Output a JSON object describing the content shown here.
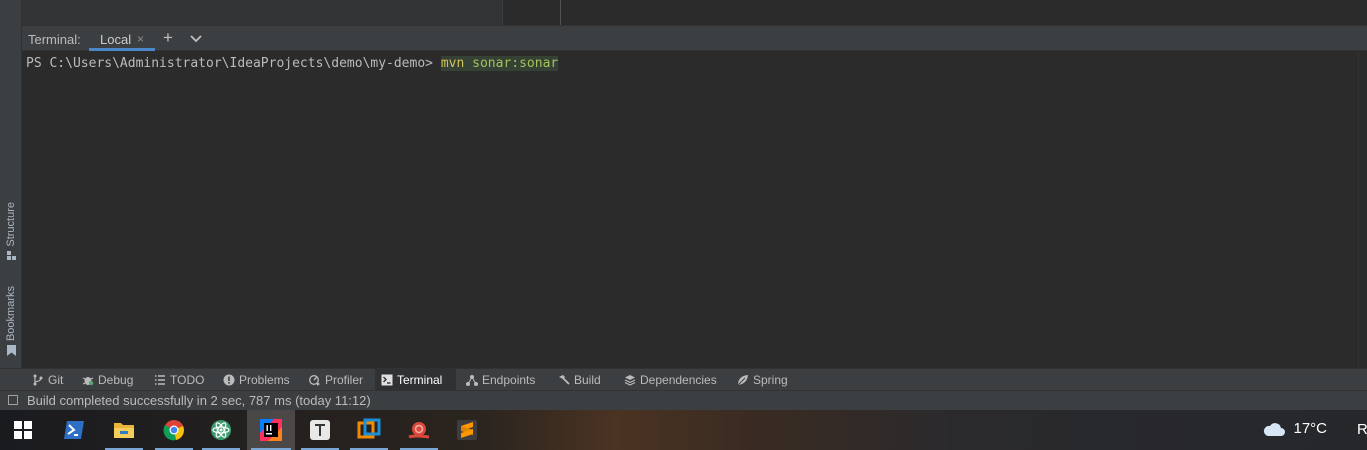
{
  "side_tabs": {
    "structure": "Structure",
    "bookmarks": "Bookmarks"
  },
  "terminal": {
    "title": "Terminal:",
    "tab_label": "Local",
    "close_glyph": "×",
    "add_glyph": "+",
    "prompt": "PS C:\\Users\\Administrator\\IdeaProjects\\demo\\my-demo> ",
    "command_program": "mvn",
    "command_args": " sonar:sonar"
  },
  "tool_windows": [
    {
      "label": "Git",
      "icon": "git-branch-icon"
    },
    {
      "label": "Debug",
      "icon": "bug-icon"
    },
    {
      "label": "TODO",
      "icon": "list-icon"
    },
    {
      "label": "Problems",
      "icon": "info-circle-icon"
    },
    {
      "label": "Profiler",
      "icon": "profiler-icon"
    },
    {
      "label": "Terminal",
      "icon": "terminal-icon",
      "active": true
    },
    {
      "label": "Endpoints",
      "icon": "endpoints-icon"
    },
    {
      "label": "Build",
      "icon": "hammer-icon"
    },
    {
      "label": "Dependencies",
      "icon": "layers-icon"
    },
    {
      "label": "Spring",
      "icon": "spring-leaf-icon"
    }
  ],
  "status": {
    "message": "Build completed successfully in 2 sec, 787 ms (today 11:12)"
  },
  "taskbar": {
    "apps": [
      "windows-start-icon",
      "powershell-icon",
      "file-explorer-icon",
      "chrome-icon",
      "atom-icon",
      "intellij-icon",
      "typora-icon",
      "vmware-icon",
      "snail-app-icon",
      "sublime-text-icon"
    ],
    "weather_temp": "17°C",
    "tray_cut_text": "R"
  },
  "colors": {
    "accent": "#4a88c7",
    "prompt_text": "#bbbbbb",
    "command": "#d1c25c",
    "command_args": "#a5c25c"
  }
}
